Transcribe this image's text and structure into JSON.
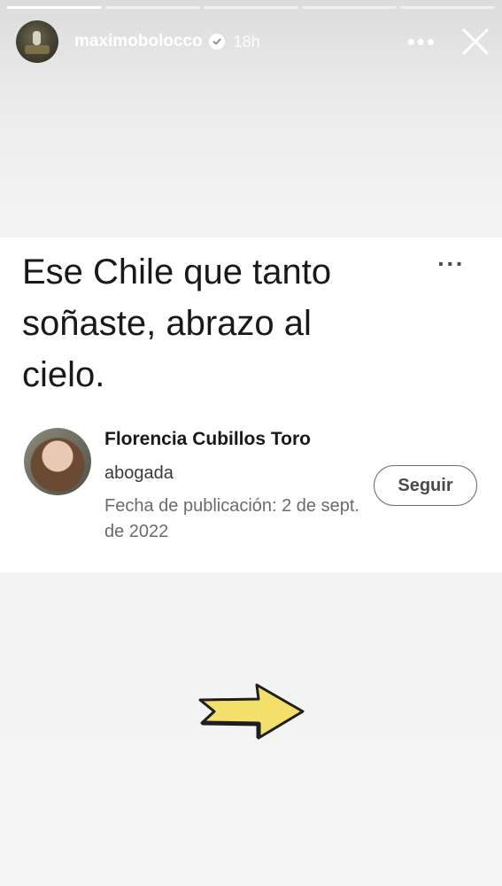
{
  "story": {
    "username": "maximobolocco",
    "time_ago": "18h",
    "progress": {
      "segments": 5,
      "current": 1
    }
  },
  "header_icons": {
    "avatar": "avatar",
    "verified": "verified-badge-icon",
    "more": "more-horizontal-icon",
    "close": "close-icon"
  },
  "post": {
    "headline": "Ese Chile que tanto soñaste, abrazo al cielo.",
    "author": {
      "name": "Florencia Cubillos Toro",
      "role": "abogada",
      "published": "Fecha de publicación: 2 de sept. de 2022"
    },
    "follow_label": "Seguir",
    "more_icon": "more-horizontal-icon"
  },
  "sticker": {
    "icon": "arrow-right-icon",
    "color": "#f3e06a"
  }
}
